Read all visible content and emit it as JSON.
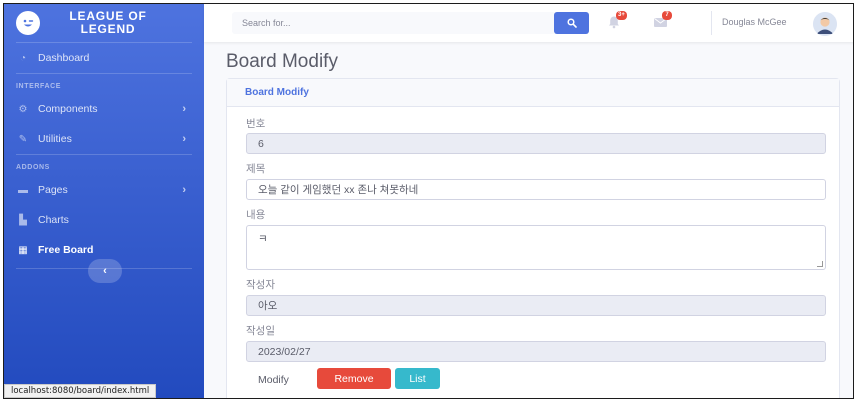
{
  "brand": {
    "line1": "LEAGUE OF",
    "line2": "LEGEND"
  },
  "sidebar": {
    "dashboard": "Dashboard",
    "heading_interface": "INTERFACE",
    "components": "Components",
    "utilities": "Utilities",
    "heading_addons": "ADDONS",
    "pages": "Pages",
    "charts": "Charts",
    "free_board": "Free Board",
    "toggle": "‹"
  },
  "status_bar": {
    "url": "localhost:8080/board/index.html"
  },
  "topbar": {
    "search_placeholder": "Search for...",
    "alerts_badge": "3+",
    "messages_badge": "7",
    "user_name": "Douglas McGee"
  },
  "page": {
    "title": "Board Modify"
  },
  "card": {
    "header": "Board Modify",
    "fields": {
      "number_label": "번호",
      "number_value": "6",
      "title_label": "제목",
      "title_value": "오늘 같이 게임했던 xx 존나 쳐못하네",
      "content_label": "내용",
      "content_value": "ㅋ",
      "writer_label": "작성자",
      "writer_value": "아오",
      "date_label": "작성일",
      "date_value": "2023/02/27"
    },
    "buttons": {
      "modify": "Modify",
      "remove": "Remove",
      "list": "List"
    }
  },
  "colors": {
    "primary": "#4e73df",
    "danger": "#e74a3b",
    "info": "#36b9cc"
  }
}
